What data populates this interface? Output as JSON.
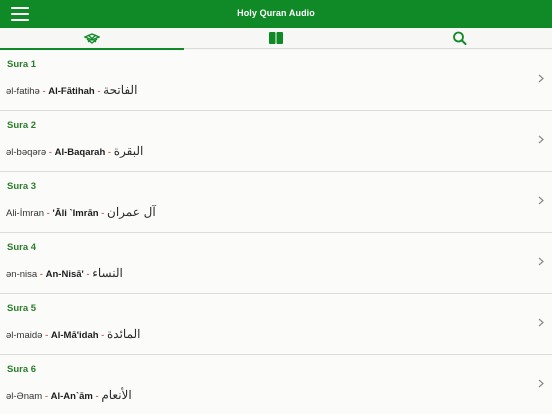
{
  "app": {
    "title": "Holy Quran Audio",
    "accent_color": "#0f8a27"
  },
  "appbar": {
    "menu_icon": "hamburger-menu-icon"
  },
  "tabs": [
    {
      "icon": "quran-book-stand-icon",
      "selected": true
    },
    {
      "icon": "open-book-icon",
      "selected": false
    },
    {
      "icon": "search-icon",
      "selected": false
    }
  ],
  "suras": [
    {
      "label": "Sura 1",
      "phonetic": "əl-fatihə",
      "sep1": " - ",
      "translit": "Al-Fātihah",
      "sep2": " - ",
      "arabic": "الفاتحة"
    },
    {
      "label": "Sura 2",
      "phonetic": "əl-bəqərə",
      "sep1": " - ",
      "translit": "Al-Baqarah",
      "sep2": " - ",
      "arabic": "البقرة"
    },
    {
      "label": "Sura 3",
      "phonetic": "Ali-İmran",
      "sep1": " - ",
      "translit": "'Āli `Imrān",
      "sep2": " - ",
      "arabic": "آل عمران"
    },
    {
      "label": "Sura 4",
      "phonetic": "ən-nisa",
      "sep1": " - ",
      "translit": "An-Nisā'",
      "sep2": " - ",
      "arabic": "النساء"
    },
    {
      "label": "Sura 5",
      "phonetic": "əl-maidə",
      "sep1": " - ",
      "translit": "Al-Mā'idah",
      "sep2": " - ",
      "arabic": "المائدة"
    },
    {
      "label": "Sura 6",
      "phonetic": "əl-Ənam",
      "sep1": " - ",
      "translit": "Al-An`ām",
      "sep2": " - ",
      "arabic": "الأنعام"
    }
  ],
  "row_chevron_icon": "chevron-right-icon"
}
